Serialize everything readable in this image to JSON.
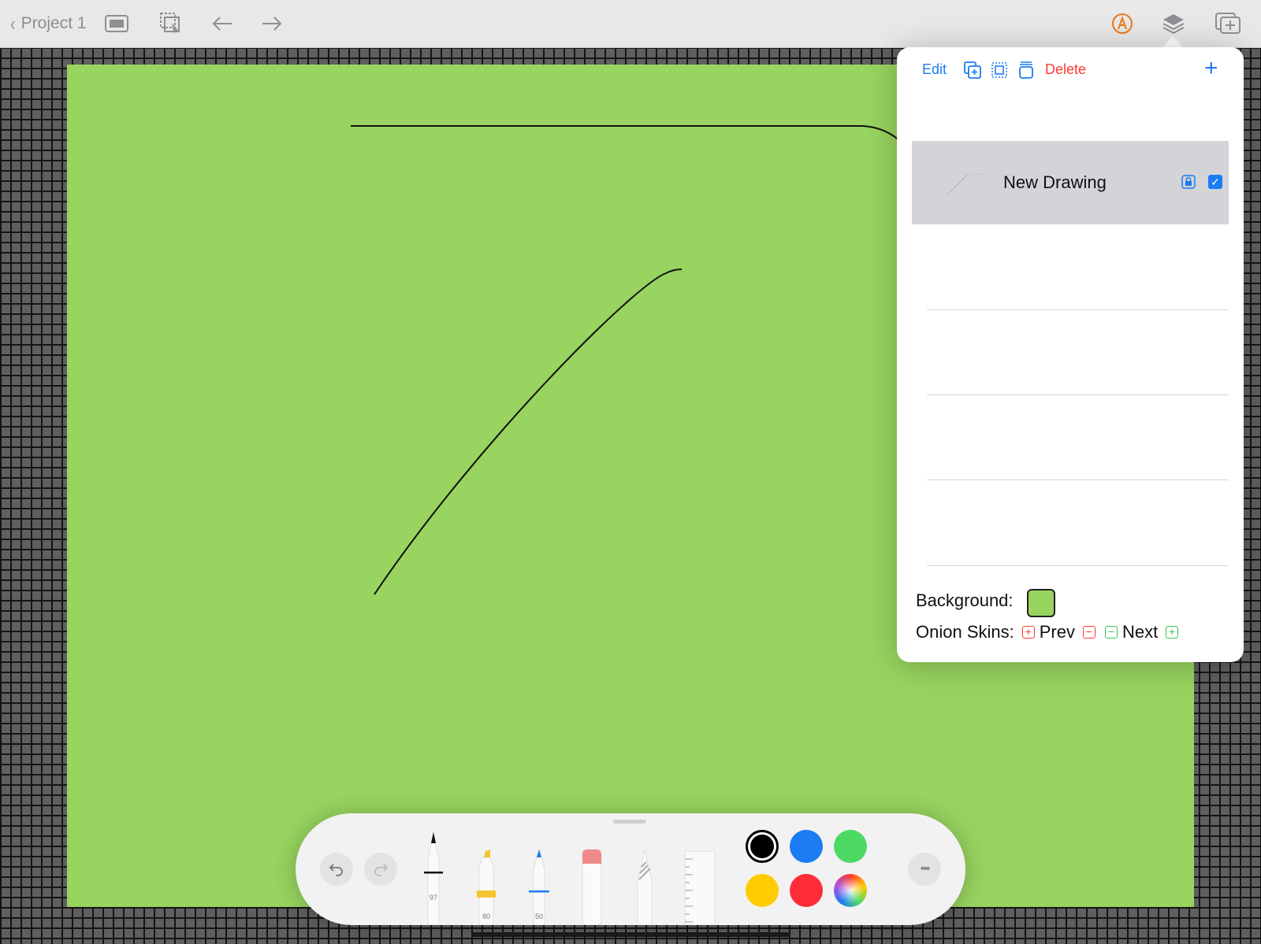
{
  "topbar": {
    "back_label": "Project 1",
    "icons": [
      "chevron-left-icon",
      "present-icon",
      "select-icon",
      "arrow-left-icon",
      "arrow-right-icon",
      "pencil-circle-icon",
      "layers-icon",
      "add-frame-icon"
    ]
  },
  "popover": {
    "edit_label": "Edit",
    "delete_label": "Delete",
    "add_label": "+",
    "layers": [
      {
        "name": "New Drawing",
        "locked": true,
        "visible": true
      }
    ],
    "background_label": "Background:",
    "background_color": "#98d45f",
    "onion_label": "Onion Skins:",
    "prev_label": "Prev",
    "next_label": "Next"
  },
  "palette": {
    "tools": [
      {
        "name": "pen",
        "value": "97"
      },
      {
        "name": "marker",
        "value": "80"
      },
      {
        "name": "pencil",
        "value": "50"
      },
      {
        "name": "eraser",
        "value": ""
      },
      {
        "name": "lasso",
        "value": ""
      },
      {
        "name": "ruler",
        "value": ""
      }
    ],
    "colors": [
      "#000000",
      "#1b7cf3",
      "#4cd964",
      "#ffcc00",
      "#ff2d3a",
      "multicolor"
    ],
    "selected_color": "#000000",
    "more_label": "•••"
  },
  "colors": {
    "canvas": "#98d45f",
    "accent": "#1b7cf3",
    "destructive": "#ff3b30",
    "toolbar_active": "#e8791a"
  }
}
